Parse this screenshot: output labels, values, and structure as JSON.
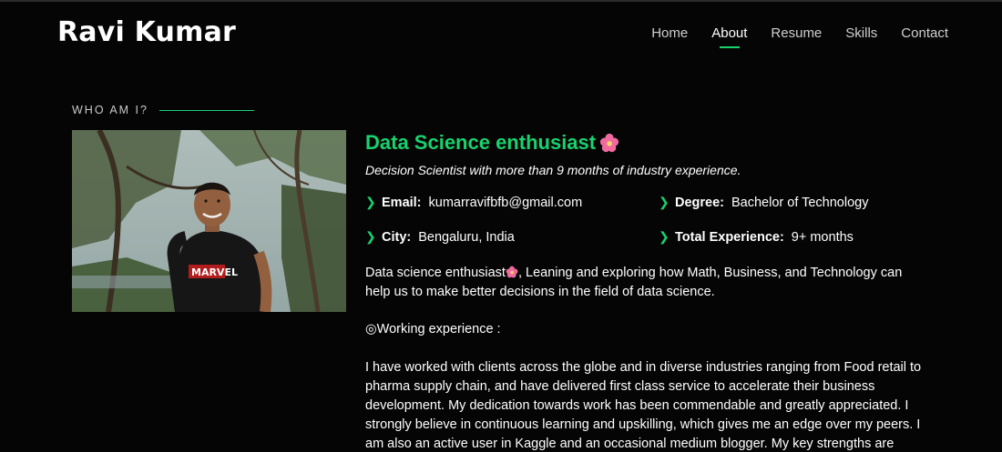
{
  "brand": "Ravi Kumar",
  "nav": {
    "items": [
      {
        "label": "Home"
      },
      {
        "label": "About"
      },
      {
        "label": "Resume"
      },
      {
        "label": "Skills"
      },
      {
        "label": "Contact"
      }
    ],
    "active": "About"
  },
  "section_label": "WHO AM I?",
  "title": "Data Science enthusiast",
  "subtitle": "Decision Scientist with more than 9 months of industry experience.",
  "info": {
    "email_label": "Email:",
    "email": "kumarravifbfb@gmail.com",
    "degree_label": "Degree:",
    "degree": "Bachelor of Technology",
    "city_label": "City:",
    "city": "Bengaluru, India",
    "exp_label": "Total Experience:",
    "exp": "9+ months"
  },
  "paragraph1_a": "Data science enthusiast",
  "paragraph1_b": ", Leaning and exploring how Math, Business, and Technology can help us to make better decisions in the field of data science.",
  "paragraph2": "◎Working experience :",
  "paragraph3": "I have worked with clients across the globe and in diverse industries ranging from Food retail to pharma supply chain, and have delivered first class service to accelerate their business development. My dedication towards work has been commendable and greatly appreciated. I strongly believe in continuous learning and upskilling, which gives me an edge over my peers. I am also an active user in Kaggle and an occasional medium blogger. My key strengths are",
  "accent_color": "#18d26e",
  "icons": {
    "nav_underline": "underline",
    "bullet": "chevron-right-icon",
    "emoji": "flower-icon"
  }
}
